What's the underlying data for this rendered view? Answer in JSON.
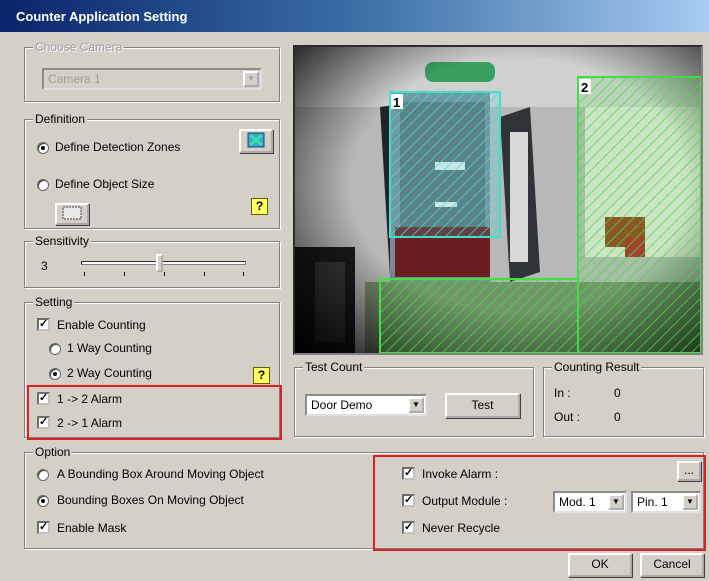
{
  "window": {
    "title": "Counter Application Setting"
  },
  "choose_camera": {
    "legend": "Choose Camera",
    "selected": "Camera 1"
  },
  "definition": {
    "legend": "Definition",
    "detection_zones_label": "Define Detection Zones",
    "object_size_label": "Define Object Size",
    "selected": "detection_zones",
    "help_mark": "?"
  },
  "sensitivity": {
    "legend": "Sensitivity",
    "value": "3",
    "level_fraction": 0.47
  },
  "setting": {
    "legend": "Setting",
    "enable_counting_label": "Enable Counting",
    "enable_counting": true,
    "one_way_label": "1 Way Counting",
    "two_way_label": "2 Way Counting",
    "selected_mode": "2way",
    "help_mark": "?",
    "alarm_1_2_label": "1 -> 2 Alarm",
    "alarm_1_2": true,
    "alarm_2_1_label": "2 -> 1 Alarm",
    "alarm_2_1": true
  },
  "preview": {
    "zone1_label": "1",
    "zone2_label": "2"
  },
  "test_count": {
    "legend": "Test Count",
    "selected": "Door Demo",
    "test_label": "Test"
  },
  "counting_result": {
    "legend": "Counting Result",
    "in_label": "In :",
    "in_value": "0",
    "out_label": "Out :",
    "out_value": "0"
  },
  "option": {
    "legend": "Option",
    "bbox_around_label": "A Bounding Box Around Moving Object",
    "bbox_on_label": "Bounding Boxes On Moving Object",
    "selected": "bbox_on",
    "enable_mask_label": "Enable Mask",
    "enable_mask": true,
    "invoke_alarm_label": "Invoke Alarm :",
    "invoke_alarm": true,
    "browse_label": "...",
    "output_module_label": "Output Module :",
    "output_module": true,
    "module_selected": "Mod. 1",
    "pin_selected": "Pin. 1",
    "never_recycle_label": "Never Recycle",
    "never_recycle": true
  },
  "footer": {
    "ok_label": "OK",
    "cancel_label": "Cancel"
  },
  "colors": {
    "title_start": "#0a246a",
    "highlight_red": "#e02020",
    "zone_cyan": "#40e0d0",
    "zone_green": "#40e040"
  }
}
